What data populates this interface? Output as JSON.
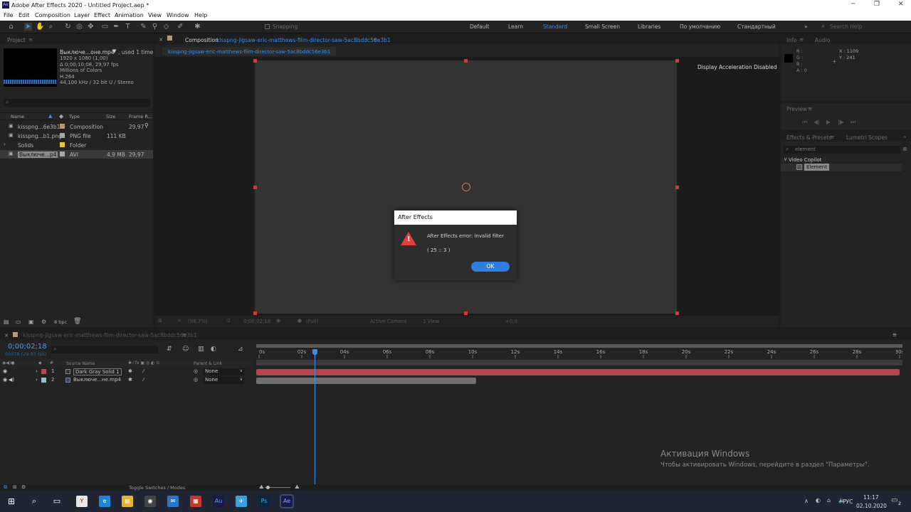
{
  "window": {
    "title": "Adobe After Effects 2020 - Untitled Project.aep *",
    "app_icon_label": "Ae",
    "controls": {
      "minimize": "─",
      "restore": "❐",
      "close": "✕"
    }
  },
  "menu": [
    "File",
    "Edit",
    "Composition",
    "Layer",
    "Effect",
    "Animation",
    "View",
    "Window",
    "Help"
  ],
  "toolbar": {
    "snapping_label": "Snapping",
    "workspaces": [
      "Default",
      "Learn",
      "Standard",
      "Small Screen",
      "Libraries",
      "По умолчанию",
      "Стандартный"
    ],
    "active_workspace": "Standard",
    "search_placeholder": "Search Help"
  },
  "project": {
    "tab_label": "Project",
    "footage": {
      "name": "Выключе…оне.mp4",
      "used": ", used 1 time",
      "lines": [
        "1920 x 1080 (1,00)",
        "Δ 0;00;10;08, 29,97 fps",
        "Millions of Colors",
        "H.264",
        "44,100 kHz / 32 bit U / Stereo"
      ]
    },
    "columns": [
      "Name",
      "Type",
      "Size",
      "Frame R..."
    ],
    "items": [
      {
        "name": "kisspng...6e3b1",
        "type": "Composition",
        "size": "",
        "fps": "29,97",
        "color": "#b59a7a",
        "selected": false
      },
      {
        "name": "kisspng...b1.png",
        "type": "PNG file",
        "size": "111 KB",
        "fps": "",
        "color": "#a9a9a9",
        "selected": false
      },
      {
        "name": "Solids",
        "type": "Folder",
        "size": "",
        "fps": "",
        "color": "#e8c53a",
        "selected": false
      },
      {
        "name": "Выключе...p4",
        "type": "AVI",
        "size": "4,9 MB",
        "fps": "29,97",
        "color": "#a9a9a9",
        "selected": true
      }
    ],
    "bpc": "8 bpc"
  },
  "composition": {
    "tab_prefix": "Composition",
    "comp_name": "kisspng-jigsaw-eric-matthews-film-director-saw-5ac8bddc56e3b1",
    "breadcrumb": "kisspng-jigsaw-eric-matthews-film-director-saw-5ac8bddc56e3b1",
    "notice": "Display Acceleration Disabled",
    "footer": {
      "zoom": "(98,7%)",
      "timecode": "0;00;02;18",
      "resolution": "(Full)",
      "camera": "Active Camera",
      "views": "1 View",
      "exposure": "+0,0"
    }
  },
  "info": {
    "tabs": [
      "Info",
      "Audio"
    ],
    "r": "R :",
    "g": "G :",
    "b": "B :",
    "a": "A : 0",
    "x": "X : 1109",
    "y": "Y : 241"
  },
  "preview": {
    "tab_label": "Preview"
  },
  "effects": {
    "tabs": [
      "Effects & Presets",
      "Lumetri Scopes"
    ],
    "search_value": "element",
    "category": "Video Copilot",
    "item": "Element"
  },
  "dialog": {
    "title": "After Effects",
    "message": "After Effects error: invalid filter",
    "code": "( 25 :: 3 )",
    "ok_label": "OK"
  },
  "timeline": {
    "tab_label": "kisspng-jigsaw-eric-matthews-film-director-saw-5ac8bddc56e3b1",
    "timecode": "0;00;02;18",
    "frame_info": "00078 (29.97 fps)",
    "current_time_seconds": 2.6,
    "duration_seconds": 30,
    "ruler_labels": [
      "0s",
      "02s",
      "04s",
      "06s",
      "08s",
      "10s",
      "12s",
      "14s",
      "16s",
      "18s",
      "20s",
      "22s",
      "24s",
      "26s",
      "28s",
      "30s"
    ],
    "columns": {
      "source": "Source Name",
      "parent": "Parent & Link"
    },
    "layers": [
      {
        "index": "1",
        "name": "Dark Gray Solid 1",
        "parent": "None",
        "color": "#c04545",
        "bar_color": "#b4454a",
        "bar_start_seconds": 0,
        "bar_end_seconds": 30
      },
      {
        "index": "2",
        "name": "Выключе...не.mp4",
        "parent": "None",
        "color": "#8fc0c9",
        "bar_color": "#6f6f6f",
        "bar_start_seconds": 0,
        "bar_end_seconds": 10.27
      }
    ],
    "toggle_label": "Toggle Switches / Modes"
  },
  "watermark": {
    "title": "Активация Windows",
    "subtitle": "Чтобы активировать Windows, перейдите в раздел \"Параметры\"."
  },
  "taskbar": {
    "apps": [
      "Y",
      "e",
      "▤",
      "◉",
      "✉",
      "▦",
      "Au",
      "✈",
      "Ps",
      "Ae"
    ],
    "language": "РУС",
    "time": "11:17",
    "date": "02.10.2020",
    "notifications": "2"
  }
}
